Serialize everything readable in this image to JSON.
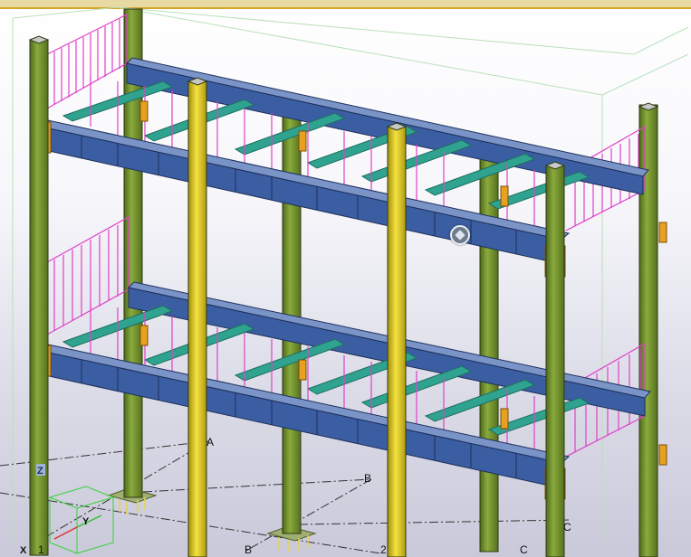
{
  "grid_labels": {
    "a_top": "A",
    "b_upper": "B",
    "b_lower": "B",
    "two": "2",
    "c_lower": "C",
    "c_right": "C",
    "one": "1"
  },
  "axes": {
    "z": "Z",
    "y": "Y",
    "x": "X"
  },
  "colors": {
    "column_green": "#6e8b2e",
    "column_yellow": "#e2cc1e",
    "beam_blue": "#3b5ea3",
    "railing_magenta": "#e040c8",
    "grating_teal": "#2fa38f",
    "gridline": "#333333"
  },
  "icons": [
    "view-cube-icon",
    "coordinate-axis-icon"
  ]
}
